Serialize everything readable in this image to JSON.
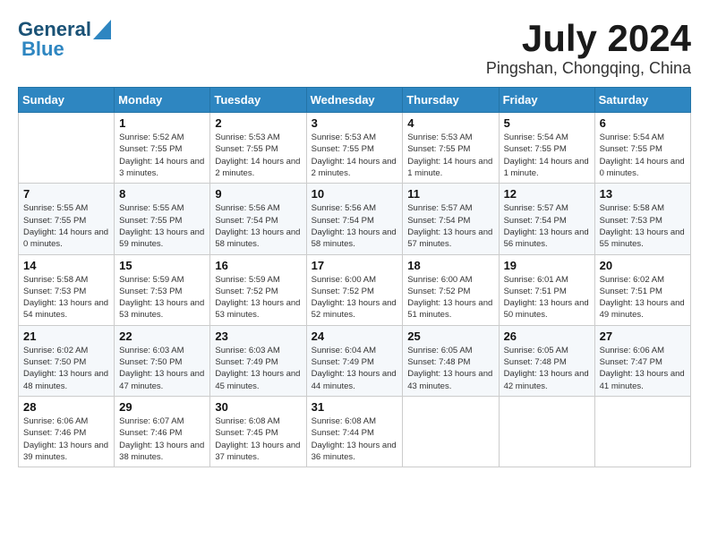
{
  "header": {
    "logo_line1": "General",
    "logo_line2": "Blue",
    "month": "July 2024",
    "location": "Pingshan, Chongqing, China"
  },
  "columns": [
    "Sunday",
    "Monday",
    "Tuesday",
    "Wednesday",
    "Thursday",
    "Friday",
    "Saturday"
  ],
  "weeks": [
    [
      {
        "day": "",
        "sunrise": "",
        "sunset": "",
        "daylight": ""
      },
      {
        "day": "1",
        "sunrise": "Sunrise: 5:52 AM",
        "sunset": "Sunset: 7:55 PM",
        "daylight": "Daylight: 14 hours and 3 minutes."
      },
      {
        "day": "2",
        "sunrise": "Sunrise: 5:53 AM",
        "sunset": "Sunset: 7:55 PM",
        "daylight": "Daylight: 14 hours and 2 minutes."
      },
      {
        "day": "3",
        "sunrise": "Sunrise: 5:53 AM",
        "sunset": "Sunset: 7:55 PM",
        "daylight": "Daylight: 14 hours and 2 minutes."
      },
      {
        "day": "4",
        "sunrise": "Sunrise: 5:53 AM",
        "sunset": "Sunset: 7:55 PM",
        "daylight": "Daylight: 14 hours and 1 minute."
      },
      {
        "day": "5",
        "sunrise": "Sunrise: 5:54 AM",
        "sunset": "Sunset: 7:55 PM",
        "daylight": "Daylight: 14 hours and 1 minute."
      },
      {
        "day": "6",
        "sunrise": "Sunrise: 5:54 AM",
        "sunset": "Sunset: 7:55 PM",
        "daylight": "Daylight: 14 hours and 0 minutes."
      }
    ],
    [
      {
        "day": "7",
        "sunrise": "Sunrise: 5:55 AM",
        "sunset": "Sunset: 7:55 PM",
        "daylight": "Daylight: 14 hours and 0 minutes."
      },
      {
        "day": "8",
        "sunrise": "Sunrise: 5:55 AM",
        "sunset": "Sunset: 7:55 PM",
        "daylight": "Daylight: 13 hours and 59 minutes."
      },
      {
        "day": "9",
        "sunrise": "Sunrise: 5:56 AM",
        "sunset": "Sunset: 7:54 PM",
        "daylight": "Daylight: 13 hours and 58 minutes."
      },
      {
        "day": "10",
        "sunrise": "Sunrise: 5:56 AM",
        "sunset": "Sunset: 7:54 PM",
        "daylight": "Daylight: 13 hours and 58 minutes."
      },
      {
        "day": "11",
        "sunrise": "Sunrise: 5:57 AM",
        "sunset": "Sunset: 7:54 PM",
        "daylight": "Daylight: 13 hours and 57 minutes."
      },
      {
        "day": "12",
        "sunrise": "Sunrise: 5:57 AM",
        "sunset": "Sunset: 7:54 PM",
        "daylight": "Daylight: 13 hours and 56 minutes."
      },
      {
        "day": "13",
        "sunrise": "Sunrise: 5:58 AM",
        "sunset": "Sunset: 7:53 PM",
        "daylight": "Daylight: 13 hours and 55 minutes."
      }
    ],
    [
      {
        "day": "14",
        "sunrise": "Sunrise: 5:58 AM",
        "sunset": "Sunset: 7:53 PM",
        "daylight": "Daylight: 13 hours and 54 minutes."
      },
      {
        "day": "15",
        "sunrise": "Sunrise: 5:59 AM",
        "sunset": "Sunset: 7:53 PM",
        "daylight": "Daylight: 13 hours and 53 minutes."
      },
      {
        "day": "16",
        "sunrise": "Sunrise: 5:59 AM",
        "sunset": "Sunset: 7:52 PM",
        "daylight": "Daylight: 13 hours and 53 minutes."
      },
      {
        "day": "17",
        "sunrise": "Sunrise: 6:00 AM",
        "sunset": "Sunset: 7:52 PM",
        "daylight": "Daylight: 13 hours and 52 minutes."
      },
      {
        "day": "18",
        "sunrise": "Sunrise: 6:00 AM",
        "sunset": "Sunset: 7:52 PM",
        "daylight": "Daylight: 13 hours and 51 minutes."
      },
      {
        "day": "19",
        "sunrise": "Sunrise: 6:01 AM",
        "sunset": "Sunset: 7:51 PM",
        "daylight": "Daylight: 13 hours and 50 minutes."
      },
      {
        "day": "20",
        "sunrise": "Sunrise: 6:02 AM",
        "sunset": "Sunset: 7:51 PM",
        "daylight": "Daylight: 13 hours and 49 minutes."
      }
    ],
    [
      {
        "day": "21",
        "sunrise": "Sunrise: 6:02 AM",
        "sunset": "Sunset: 7:50 PM",
        "daylight": "Daylight: 13 hours and 48 minutes."
      },
      {
        "day": "22",
        "sunrise": "Sunrise: 6:03 AM",
        "sunset": "Sunset: 7:50 PM",
        "daylight": "Daylight: 13 hours and 47 minutes."
      },
      {
        "day": "23",
        "sunrise": "Sunrise: 6:03 AM",
        "sunset": "Sunset: 7:49 PM",
        "daylight": "Daylight: 13 hours and 45 minutes."
      },
      {
        "day": "24",
        "sunrise": "Sunrise: 6:04 AM",
        "sunset": "Sunset: 7:49 PM",
        "daylight": "Daylight: 13 hours and 44 minutes."
      },
      {
        "day": "25",
        "sunrise": "Sunrise: 6:05 AM",
        "sunset": "Sunset: 7:48 PM",
        "daylight": "Daylight: 13 hours and 43 minutes."
      },
      {
        "day": "26",
        "sunrise": "Sunrise: 6:05 AM",
        "sunset": "Sunset: 7:48 PM",
        "daylight": "Daylight: 13 hours and 42 minutes."
      },
      {
        "day": "27",
        "sunrise": "Sunrise: 6:06 AM",
        "sunset": "Sunset: 7:47 PM",
        "daylight": "Daylight: 13 hours and 41 minutes."
      }
    ],
    [
      {
        "day": "28",
        "sunrise": "Sunrise: 6:06 AM",
        "sunset": "Sunset: 7:46 PM",
        "daylight": "Daylight: 13 hours and 39 minutes."
      },
      {
        "day": "29",
        "sunrise": "Sunrise: 6:07 AM",
        "sunset": "Sunset: 7:46 PM",
        "daylight": "Daylight: 13 hours and 38 minutes."
      },
      {
        "day": "30",
        "sunrise": "Sunrise: 6:08 AM",
        "sunset": "Sunset: 7:45 PM",
        "daylight": "Daylight: 13 hours and 37 minutes."
      },
      {
        "day": "31",
        "sunrise": "Sunrise: 6:08 AM",
        "sunset": "Sunset: 7:44 PM",
        "daylight": "Daylight: 13 hours and 36 minutes."
      },
      {
        "day": "",
        "sunrise": "",
        "sunset": "",
        "daylight": ""
      },
      {
        "day": "",
        "sunrise": "",
        "sunset": "",
        "daylight": ""
      },
      {
        "day": "",
        "sunrise": "",
        "sunset": "",
        "daylight": ""
      }
    ]
  ]
}
